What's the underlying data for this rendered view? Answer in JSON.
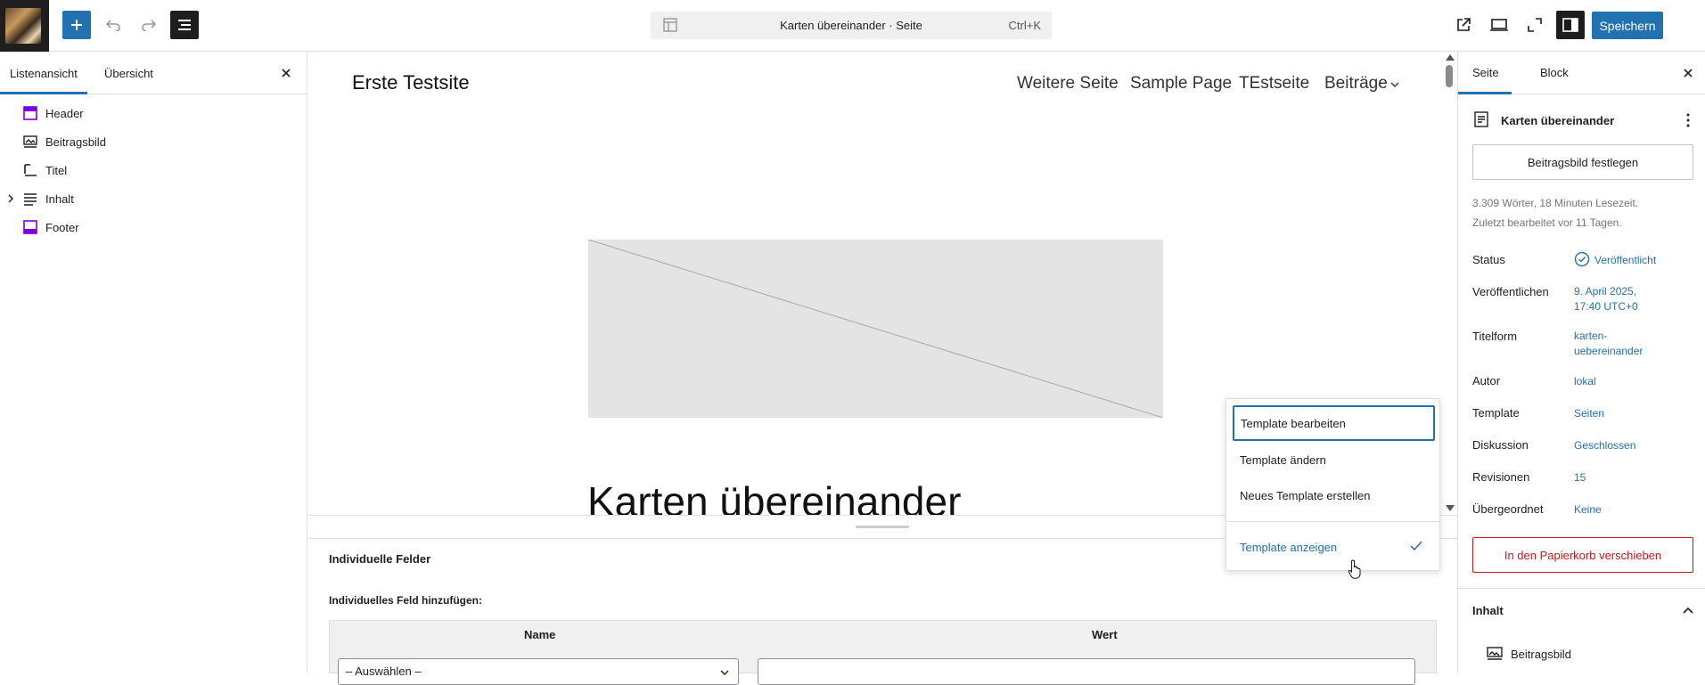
{
  "topbar": {
    "document_title": "Karten übereinander · Seite",
    "shortcut": "Ctrl+K",
    "save_label": "Speichern"
  },
  "left_panel": {
    "tabs": [
      "Listenansicht",
      "Übersicht"
    ],
    "items": [
      {
        "label": "Header",
        "icon": "template-part-icon"
      },
      {
        "label": "Beitragsbild",
        "icon": "featured-image-icon"
      },
      {
        "label": "Titel",
        "icon": "title-icon"
      },
      {
        "label": "Inhalt",
        "icon": "content-icon"
      },
      {
        "label": "Footer",
        "icon": "template-part-icon"
      }
    ]
  },
  "canvas": {
    "site_title": "Erste Testsite",
    "nav": [
      "Weitere Seite",
      "Sample Page",
      "TEstseite",
      "Beiträge"
    ],
    "page_heading": "Karten übereinander"
  },
  "metaboxes": {
    "title": "Individuelle Felder",
    "add_label": "Individuelles Feld hinzufügen:",
    "col_name": "Name",
    "col_value": "Wert",
    "select_value": "– Auswählen –"
  },
  "dropdown": {
    "items": [
      "Template bearbeiten",
      "Template ändern",
      "Neues Template erstellen",
      "Template anzeigen"
    ]
  },
  "sidebar": {
    "tabs": [
      "Seite",
      "Block"
    ],
    "doc_title": "Karten übereinander",
    "featured_button": "Beitragsbild festlegen",
    "meta_line1": "3.309 Wörter, 18 Minuten Lesezeit.",
    "meta_line2": "Zuletzt bearbeitet vor 11 Tagen.",
    "rows": [
      {
        "label": "Status",
        "value": "Veröffentlicht"
      },
      {
        "label": "Veröffentlichen",
        "value1": "9. April 2025,",
        "value2": "17:40 UTC+0"
      },
      {
        "label": "Titelform",
        "value1": "karten-",
        "value2": "uebereinander"
      },
      {
        "label": "Autor",
        "value": "lokal"
      },
      {
        "label": "Template",
        "value": "Seiten"
      },
      {
        "label": "Diskussion",
        "value": "Geschlossen"
      },
      {
        "label": "Revisionen",
        "value": "15"
      },
      {
        "label": "Übergeordnet",
        "value": "Keine"
      }
    ],
    "trash_button": "In den Papierkorb verschieben",
    "content_title": "Inhalt",
    "content_item": "Beitragsbild"
  },
  "colors": {
    "accent": "#2271b1",
    "danger": "#cc1818"
  }
}
